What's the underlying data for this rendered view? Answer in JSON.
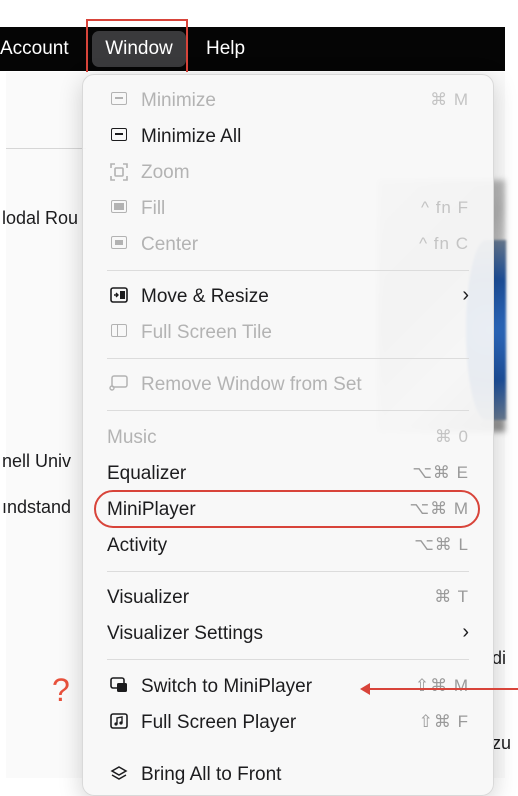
{
  "menubar": {
    "account": "Account",
    "window": "Window",
    "help": "Help"
  },
  "background": {
    "line1": "lodal Rou",
    "line2": "nell Univ",
    "line3": "ındstand",
    "side1": "di",
    "side2": "zu"
  },
  "annotation": {
    "question": "?"
  },
  "menu": {
    "minimize": {
      "label": "Minimize",
      "shortcut": "⌘ M"
    },
    "minimize_all": {
      "label": "Minimize All"
    },
    "zoom": {
      "label": "Zoom"
    },
    "fill": {
      "label": "Fill",
      "shortcut": "^ fn F"
    },
    "center": {
      "label": "Center",
      "shortcut": "^ fn C"
    },
    "move_resize": {
      "label": "Move & Resize",
      "arrow": "›"
    },
    "full_screen_tile": {
      "label": "Full Screen Tile"
    },
    "remove_window": {
      "label": "Remove Window from Set"
    },
    "music": {
      "label": "Music",
      "shortcut": "⌘ 0"
    },
    "equalizer": {
      "label": "Equalizer",
      "shortcut": "⌥⌘ E"
    },
    "miniplayer": {
      "label": "MiniPlayer",
      "shortcut": "⌥⌘ M"
    },
    "activity": {
      "label": "Activity",
      "shortcut": "⌥⌘ L"
    },
    "visualizer": {
      "label": "Visualizer",
      "shortcut": "⌘ T"
    },
    "visualizer_settings": {
      "label": "Visualizer Settings",
      "arrow": "›"
    },
    "switch_miniplayer": {
      "label": "Switch to MiniPlayer",
      "shortcut": "⇧⌘ M"
    },
    "full_screen_player": {
      "label": "Full Screen Player",
      "shortcut": "⇧⌘ F"
    },
    "bring_all_front": {
      "label": "Bring All to Front"
    }
  },
  "icons": {
    "minimize": "minimize-icon",
    "minimize_all": "minimize-all-icon",
    "zoom": "zoom-icon",
    "fill": "fill-icon",
    "center": "center-icon",
    "move_resize": "move-resize-icon",
    "full_screen_tile": "full-screen-tile-icon",
    "remove_window": "remove-window-icon",
    "switch_miniplayer": "switch-miniplayer-icon",
    "full_screen_player": "full-screen-player-icon",
    "bring_all_front": "bring-all-front-icon"
  },
  "colors": {
    "annotation_red": "#d8443a",
    "menubar_bg": "#050505",
    "menu_bg": "#f7f7f7",
    "disabled_text": "#b3b3b3"
  }
}
